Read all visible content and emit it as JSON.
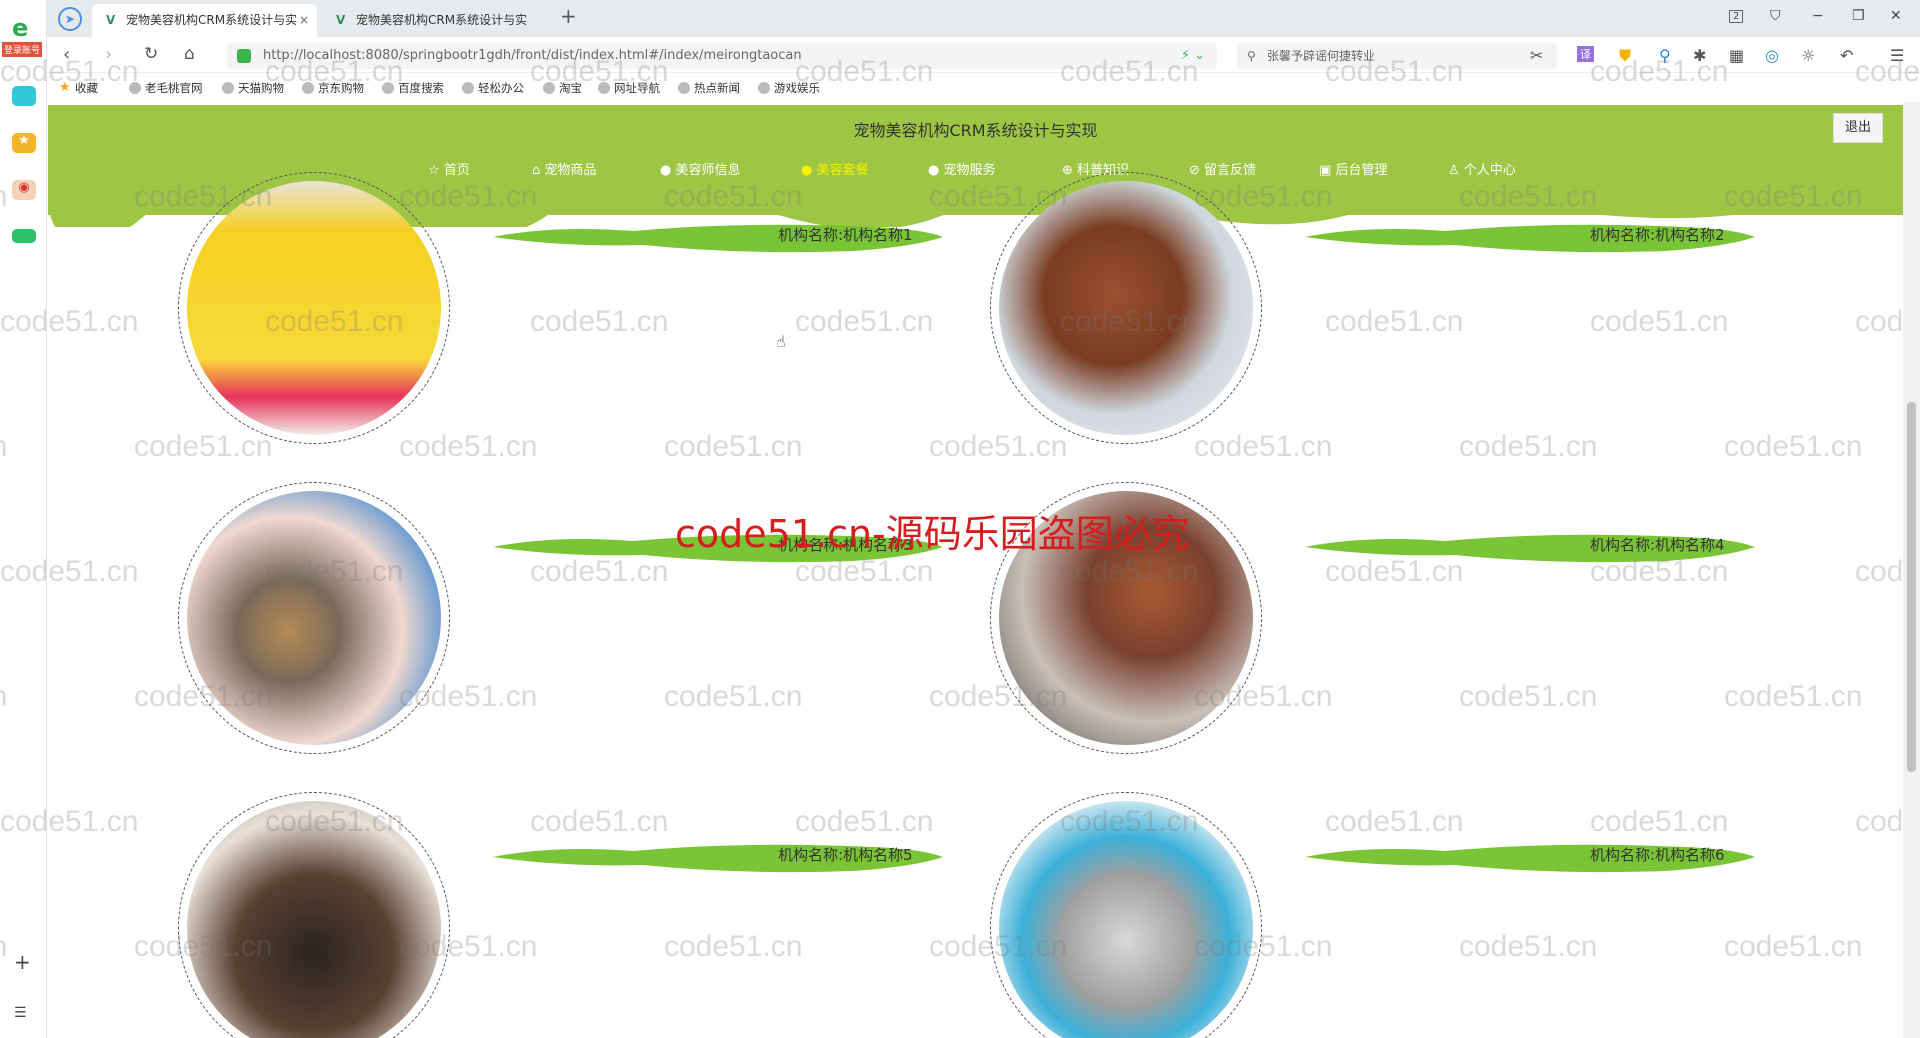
{
  "browser": {
    "tabs": [
      {
        "title": "宠物美容机构CRM系统设计与实",
        "close": "×"
      },
      {
        "title": "宠物美容机构CRM系统设计与实"
      }
    ],
    "new_tab": "+",
    "window_badge": "2",
    "url": "http://localhost:8080/springbootr1gdh/front/dist/index.html#/index/meirongtaocan",
    "search_placeholder": "张馨予辟谣何捷转业",
    "login_badge": "登录账号",
    "bookmarks": [
      "收藏",
      "老毛桃官网",
      "天猫购物",
      "京东购物",
      "百度搜索",
      "轻松办公",
      "淘宝",
      "网址导航",
      "热点新闻",
      "游戏娱乐"
    ]
  },
  "site": {
    "title": "宠物美容机构CRM系统设计与实现",
    "logout": "退出",
    "menu": [
      {
        "icon": "☆",
        "label": "首页"
      },
      {
        "icon": "⌂",
        "label": "宠物商品"
      },
      {
        "icon": "●",
        "label": "美容师信息"
      },
      {
        "icon": "●",
        "label": "美容套餐",
        "active": true
      },
      {
        "icon": "●",
        "label": "宠物服务"
      },
      {
        "icon": "⊕",
        "label": "科普知识"
      },
      {
        "icon": "⊘",
        "label": "留言反馈"
      },
      {
        "icon": "▣",
        "label": "后台管理"
      },
      {
        "icon": "♙",
        "label": "个人中心"
      }
    ],
    "accent": "#9ec645",
    "active_menu_color": "#f5f200"
  },
  "cards": [
    {
      "name": "机构名称:机构名称1",
      "image": "price-list-poster"
    },
    {
      "name": "机构名称:机构名称2",
      "image": "poodle-grooming"
    },
    {
      "name": "机构名称:机构名称3",
      "image": "yorkie-grooming"
    },
    {
      "name": "机构名称:机构名称4",
      "image": "poodle-trimming"
    },
    {
      "name": "机构名称:机构名称5",
      "image": "bernese-dog"
    },
    {
      "name": "机构名称:机构名称6",
      "image": "shih-tzu-curlers"
    }
  ],
  "watermark": {
    "text": "code51.cn",
    "center": "code51.cn-源码乐园盗图必究"
  }
}
